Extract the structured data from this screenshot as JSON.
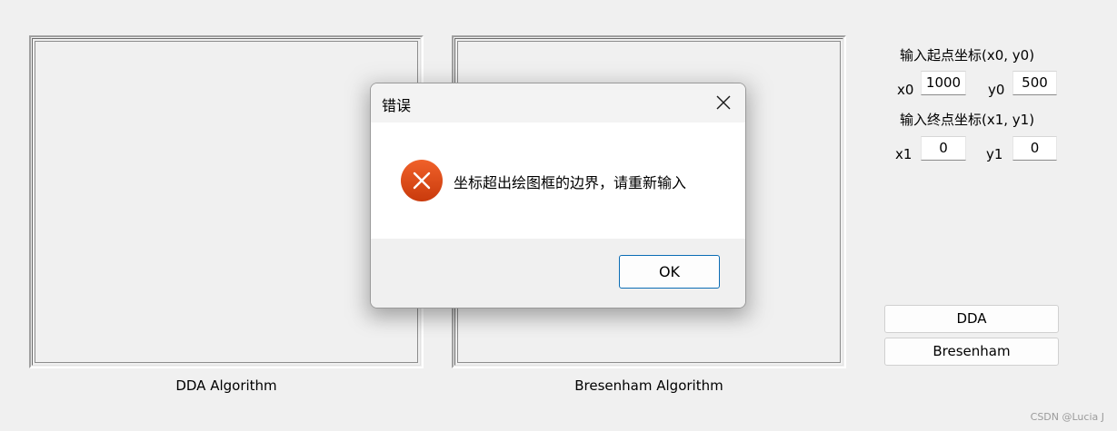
{
  "main": {
    "dda_caption": "DDA Algorithm",
    "bresenham_caption": "Bresenham Algorithm"
  },
  "controls": {
    "start_label": "输入起点坐标(x0, y0)",
    "end_label": "输入终点坐标(x1, y1)",
    "x0_label": "x0",
    "y0_label": "y0",
    "x1_label": "x1",
    "y1_label": "y1",
    "x0_value": "1000",
    "y0_value": "500",
    "x1_value": "0",
    "y1_value": "0",
    "dda_button": "DDA",
    "bresenham_button": "Bresenham"
  },
  "dialog": {
    "title": "错误",
    "message": "坐标超出绘图框的边界，请重新输入",
    "ok_label": "OK",
    "icon": "error-icon",
    "close_icon": "close-icon"
  },
  "watermark": "CSDN @Lucia J",
  "colors": {
    "error_icon": "#e04a10",
    "ok_border": "#0a6cb4",
    "window_bg": "#f0f0f0"
  }
}
